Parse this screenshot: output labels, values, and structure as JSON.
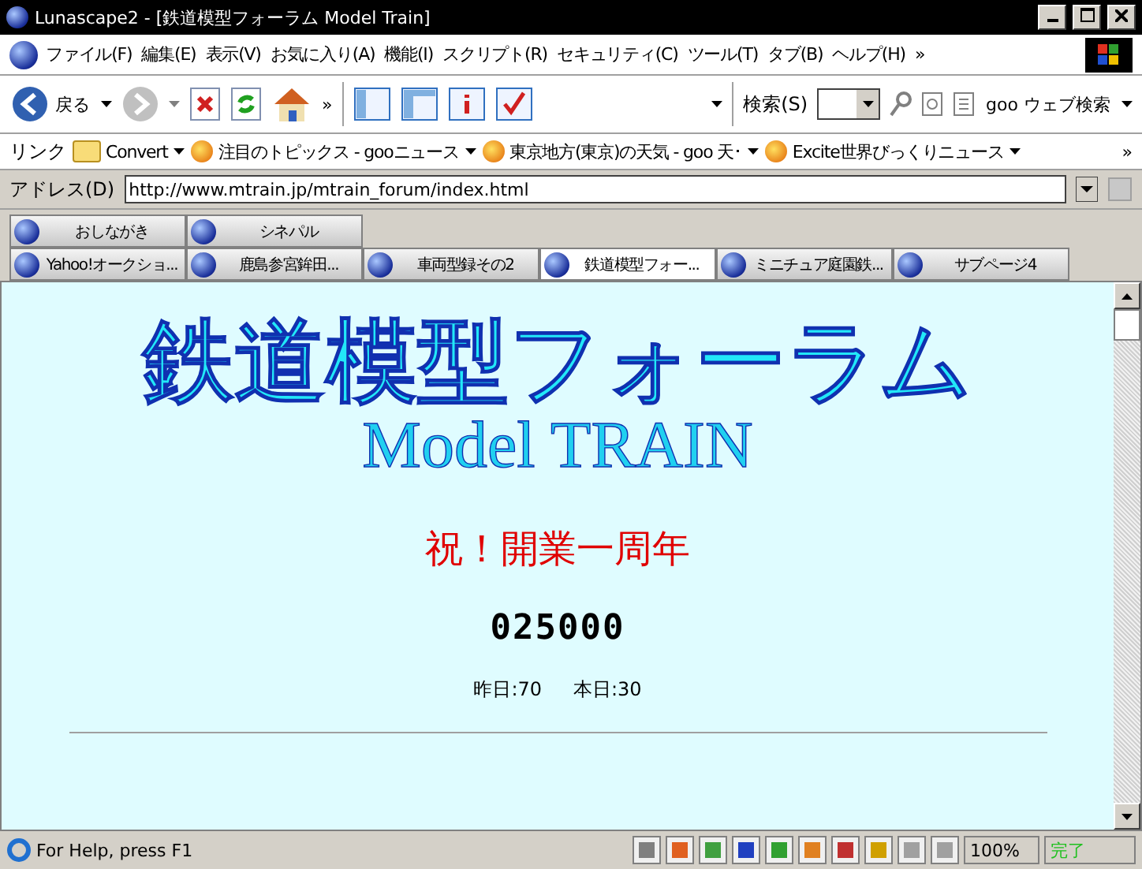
{
  "window": {
    "title": "Lunascape2 - [鉄道模型フォーラム Model Train]"
  },
  "menu": [
    "ファイル(F)",
    "編集(E)",
    "表示(V)",
    "お気に入り(A)",
    "機能(I)",
    "スクリプト(R)",
    "セキュリティ(C)",
    "ツール(T)",
    "タブ(B)",
    "ヘルプ(H)",
    "»"
  ],
  "toolbar": {
    "back": "戻る",
    "more": "»",
    "search_label": "検索(S)",
    "search_engine": "goo ウェブ検索"
  },
  "links": {
    "label": "リンク",
    "items": [
      {
        "kind": "folder",
        "label": "Convert"
      },
      {
        "kind": "site",
        "label": "注目のトピックス - gooニュース"
      },
      {
        "kind": "site",
        "label": "東京地方(東京)の天気 - goo 天･"
      },
      {
        "kind": "site",
        "label": "Excite世界びっくりニュース"
      }
    ],
    "more": "»"
  },
  "address": {
    "label": "アドレス(D)",
    "url": "http://www.mtrain.jp/mtrain_forum/index.html"
  },
  "tab_rows": [
    [
      {
        "label": "おしながき",
        "selected": false
      },
      {
        "label": "シネパル",
        "selected": false
      }
    ],
    [
      {
        "label": "Yahoo!オークショ...",
        "selected": false
      },
      {
        "label": "鹿島参宮鉾田...",
        "selected": false
      },
      {
        "label": "車両型録その2",
        "selected": false
      },
      {
        "label": "鉄道模型フォー...",
        "selected": true
      },
      {
        "label": "ミニチュア庭園鉄...",
        "selected": false
      },
      {
        "label": "サブページ4",
        "selected": false
      }
    ]
  ],
  "page": {
    "heading": "鉄道模型フォーラム",
    "subtitle": "Model TRAIN",
    "announcement": "祝！開業一周年",
    "counter": "025000",
    "stats": [
      "昨日:70",
      "本日:30"
    ]
  },
  "status_bar": {
    "text": "For Help, press F1",
    "zoom": "100%",
    "state": "完了"
  }
}
